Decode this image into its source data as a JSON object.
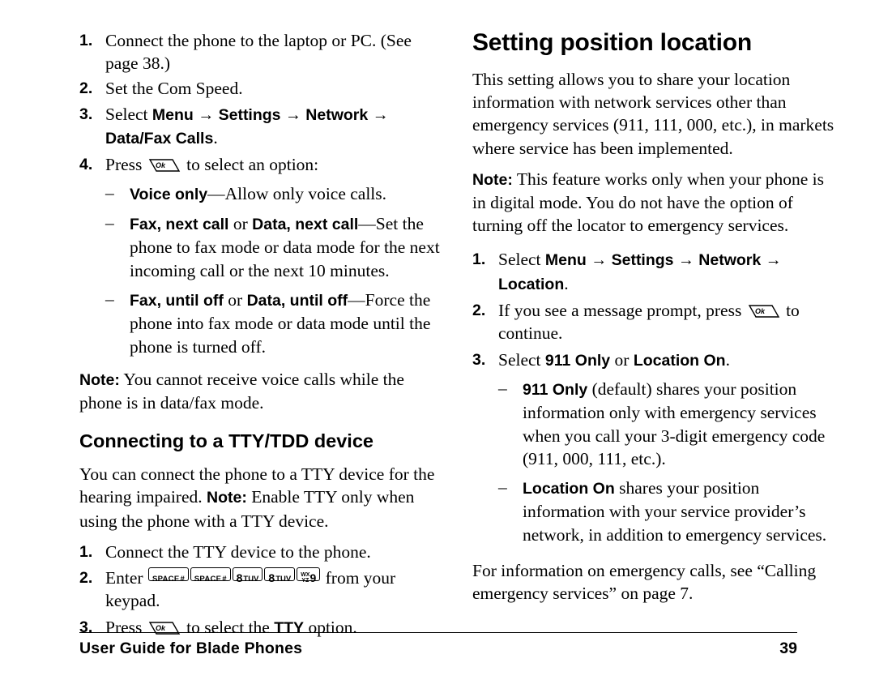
{
  "page": {
    "number": "39",
    "footer_title": "User Guide for Blade Phones"
  },
  "left_column": {
    "list1": {
      "item1": {
        "num": "1.",
        "text": "Connect the phone to the laptop or PC. (See page 38.)"
      },
      "item2": {
        "num": "2.",
        "text": "Set the Com Speed."
      },
      "item3": {
        "num": "3.",
        "label_select": "Select",
        "menu": "Menu",
        "arrow1": "→",
        "settings": "Settings",
        "arrow2": "→",
        "network": "Network",
        "arrow3": "→",
        "datafax": "Data/Fax Calls",
        "period": "."
      },
      "item4": {
        "num": "4.",
        "label_press": "Press",
        "key": "ok-key",
        "text_after": "to select an option:"
      }
    },
    "sublist": {
      "item1": {
        "dash": "–",
        "bold": "Voice only",
        "rest": "—Allow only voice calls."
      },
      "item2": {
        "dash": "–",
        "bold1": "Fax, next call",
        "or": "or",
        "bold2": "Data, next call",
        "rest": "—Set the phone to fax mode or data mode for the next incoming call or the next 10 minutes."
      },
      "item3": {
        "dash": "–",
        "bold1": "Fax, until off",
        "or": "or",
        "bold2": "Data, until off",
        "rest": "—Force the phone into fax mode or data mode until the phone is turned off."
      }
    },
    "note": {
      "label": "Note:",
      "text": "You cannot receive voice calls while the phone is in data/fax mode."
    },
    "heading": "Connecting to a TTY/TDD device",
    "body": {
      "text1": "You can connect the phone to a TTY device for the hearing impaired.",
      "note_label": "Note:",
      "text2": "Enable TTY only when using the phone with a TTY device."
    },
    "list2": {
      "item1": {
        "num": "1.",
        "text": "Connect the TTY device to the phone."
      },
      "item2": {
        "num": "2.",
        "label_enter": "Enter",
        "keys": [
          {
            "name": "space-pound-key",
            "label": "SPACE",
            "symbol": "#"
          },
          {
            "name": "space-pound-key",
            "label": "SPACE",
            "symbol": "#"
          },
          {
            "name": "eight-tuv-key",
            "digit": "8",
            "letters": "TUV"
          },
          {
            "name": "eight-tuv-key",
            "digit": "8",
            "letters": "TUV"
          },
          {
            "name": "nine-wxyz-key",
            "digit": "9",
            "letters_top": "WX",
            "letters_bottom": "YZ"
          }
        ],
        "text_after": "from your keypad."
      },
      "item3": {
        "num": "3.",
        "label_press": "Press",
        "key": "ok-key",
        "text_mid": "to select the",
        "bold": "TTY",
        "text_after": "option."
      }
    }
  },
  "right_column": {
    "heading": "Setting position location",
    "intro": "This setting allows you to share your location information with network services other than emergency services (911, 111, 000, etc.), in markets where service has been implemented.",
    "note": {
      "label": "Note:",
      "text": "This feature works only when your phone is in digital mode. You do not have the option of turning off the locator to emergency services."
    },
    "list": {
      "item1": {
        "num": "1.",
        "label_select": "Select",
        "menu": "Menu",
        "arrow1": "→",
        "settings": "Settings",
        "arrow2": "→",
        "network": "Network",
        "arrow3": "→",
        "location": "Location",
        "period": "."
      },
      "item2": {
        "num": "2.",
        "text_before": "If you see a message prompt, press",
        "key": "ok-key",
        "text_after": "to continue."
      },
      "item3": {
        "num": "3.",
        "label_select": "Select",
        "bold1": "911 Only",
        "or": "or",
        "bold2": "Location On",
        "period": "."
      }
    },
    "sublist": {
      "item1": {
        "dash": "–",
        "bold": "911 Only",
        "rest": "(default) shares your position information only with emergency services when you call your 3-digit emergency code (911, 000, 111, etc.)."
      },
      "item2": {
        "dash": "–",
        "bold": "Location On",
        "rest": "shares your position information with your service provider’s network, in addition to emergency services."
      }
    },
    "closing": "For information on emergency calls, see “Calling emergency services” on page 7."
  }
}
